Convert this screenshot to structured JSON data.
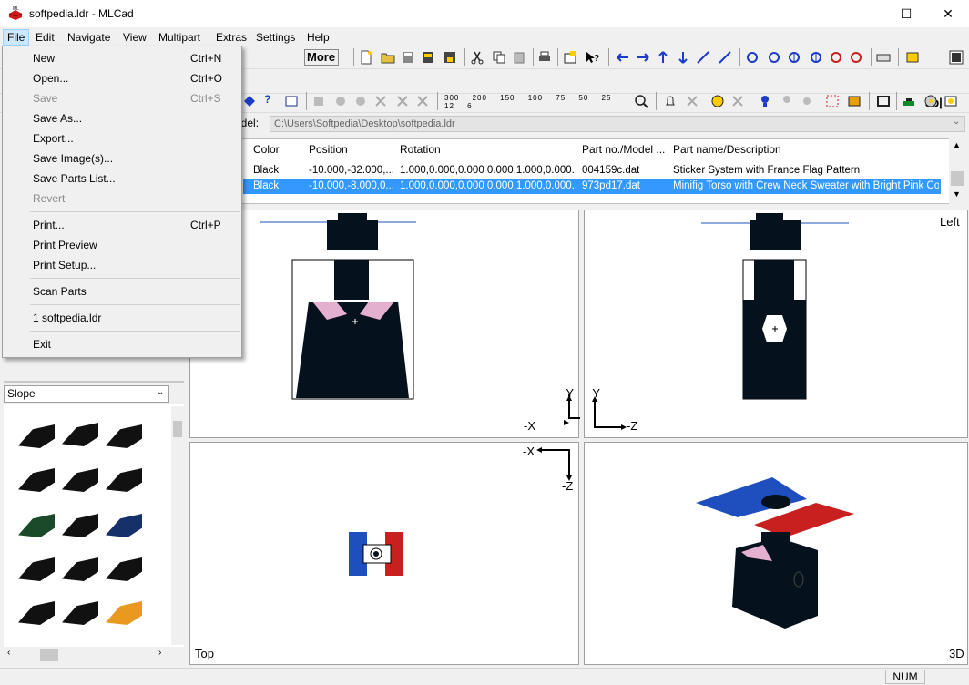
{
  "window": {
    "title": "softpedia.ldr - MLCad",
    "minimize": "—",
    "maximize": "☐",
    "close": "✕"
  },
  "menubar": [
    "File",
    "Edit",
    "Navigate",
    "View",
    "Multipart",
    "Extras",
    "Settings",
    "Help"
  ],
  "toolbar": {
    "more_label": "More"
  },
  "model_path": {
    "label": "odel:",
    "value": "C:\\Users\\Softpedia\\Desktop\\softpedia.ldr"
  },
  "table": {
    "headers": [
      "Color",
      "Position",
      "Rotation",
      "Part no./Model ...",
      "Part name/Description"
    ],
    "rows": [
      {
        "color": "Black",
        "position": "-10.000,-32.000,...",
        "rotation": "1.000,0.000,0.000 0.000,1.000,0.000...",
        "part": "004159c.dat",
        "desc": "Sticker System with France Flag Pattern",
        "selected": false
      },
      {
        "color": "Black",
        "position": "-10.000,-8.000,0...",
        "rotation": "1.000,0.000,0.000 0.000,1.000,0.000...",
        "part": "973pd17.dat",
        "desc": "Minifig Torso with Crew Neck Sweater with Bright Pink Coll...",
        "selected": true
      }
    ]
  },
  "views": {
    "front": {
      "axis_y": "-Y",
      "axis_x": "-X"
    },
    "left": {
      "label": "Left",
      "axis_y": "-Y",
      "axis_z": "-Z"
    },
    "top": {
      "label": "Top",
      "axis_x": "-X",
      "axis_z": "-Z"
    },
    "3d": {
      "label": "3D"
    }
  },
  "parts_panel": {
    "category": "Slope"
  },
  "status": {
    "num": "NUM"
  },
  "file_menu": {
    "items": [
      {
        "label": "New",
        "shortcut": "Ctrl+N",
        "disabled": false
      },
      {
        "label": "Open...",
        "shortcut": "Ctrl+O",
        "disabled": false
      },
      {
        "label": "Save",
        "shortcut": "Ctrl+S",
        "disabled": true
      },
      {
        "label": "Save As...",
        "shortcut": "",
        "disabled": false
      },
      {
        "label": "Export...",
        "shortcut": "",
        "disabled": false
      },
      {
        "label": "Save Image(s)...",
        "shortcut": "",
        "disabled": false
      },
      {
        "label": "Save Parts List...",
        "shortcut": "",
        "disabled": false
      },
      {
        "label": "Revert",
        "shortcut": "",
        "disabled": true
      },
      {
        "label": "Print...",
        "shortcut": "Ctrl+P",
        "disabled": false
      },
      {
        "label": "Print Preview",
        "shortcut": "",
        "disabled": false
      },
      {
        "label": "Print Setup...",
        "shortcut": "",
        "disabled": false
      },
      {
        "label": "Scan Parts",
        "shortcut": "",
        "disabled": false
      },
      {
        "label": "1 softpedia.ldr",
        "shortcut": "",
        "disabled": false
      },
      {
        "label": "Exit",
        "shortcut": "",
        "disabled": false
      }
    ]
  },
  "colors": {
    "accent": "#3399ff",
    "flag_blue": "#1f4fbf",
    "flag_red": "#c8201e",
    "brick": "#05111c",
    "pink": "#e3b1cf"
  }
}
